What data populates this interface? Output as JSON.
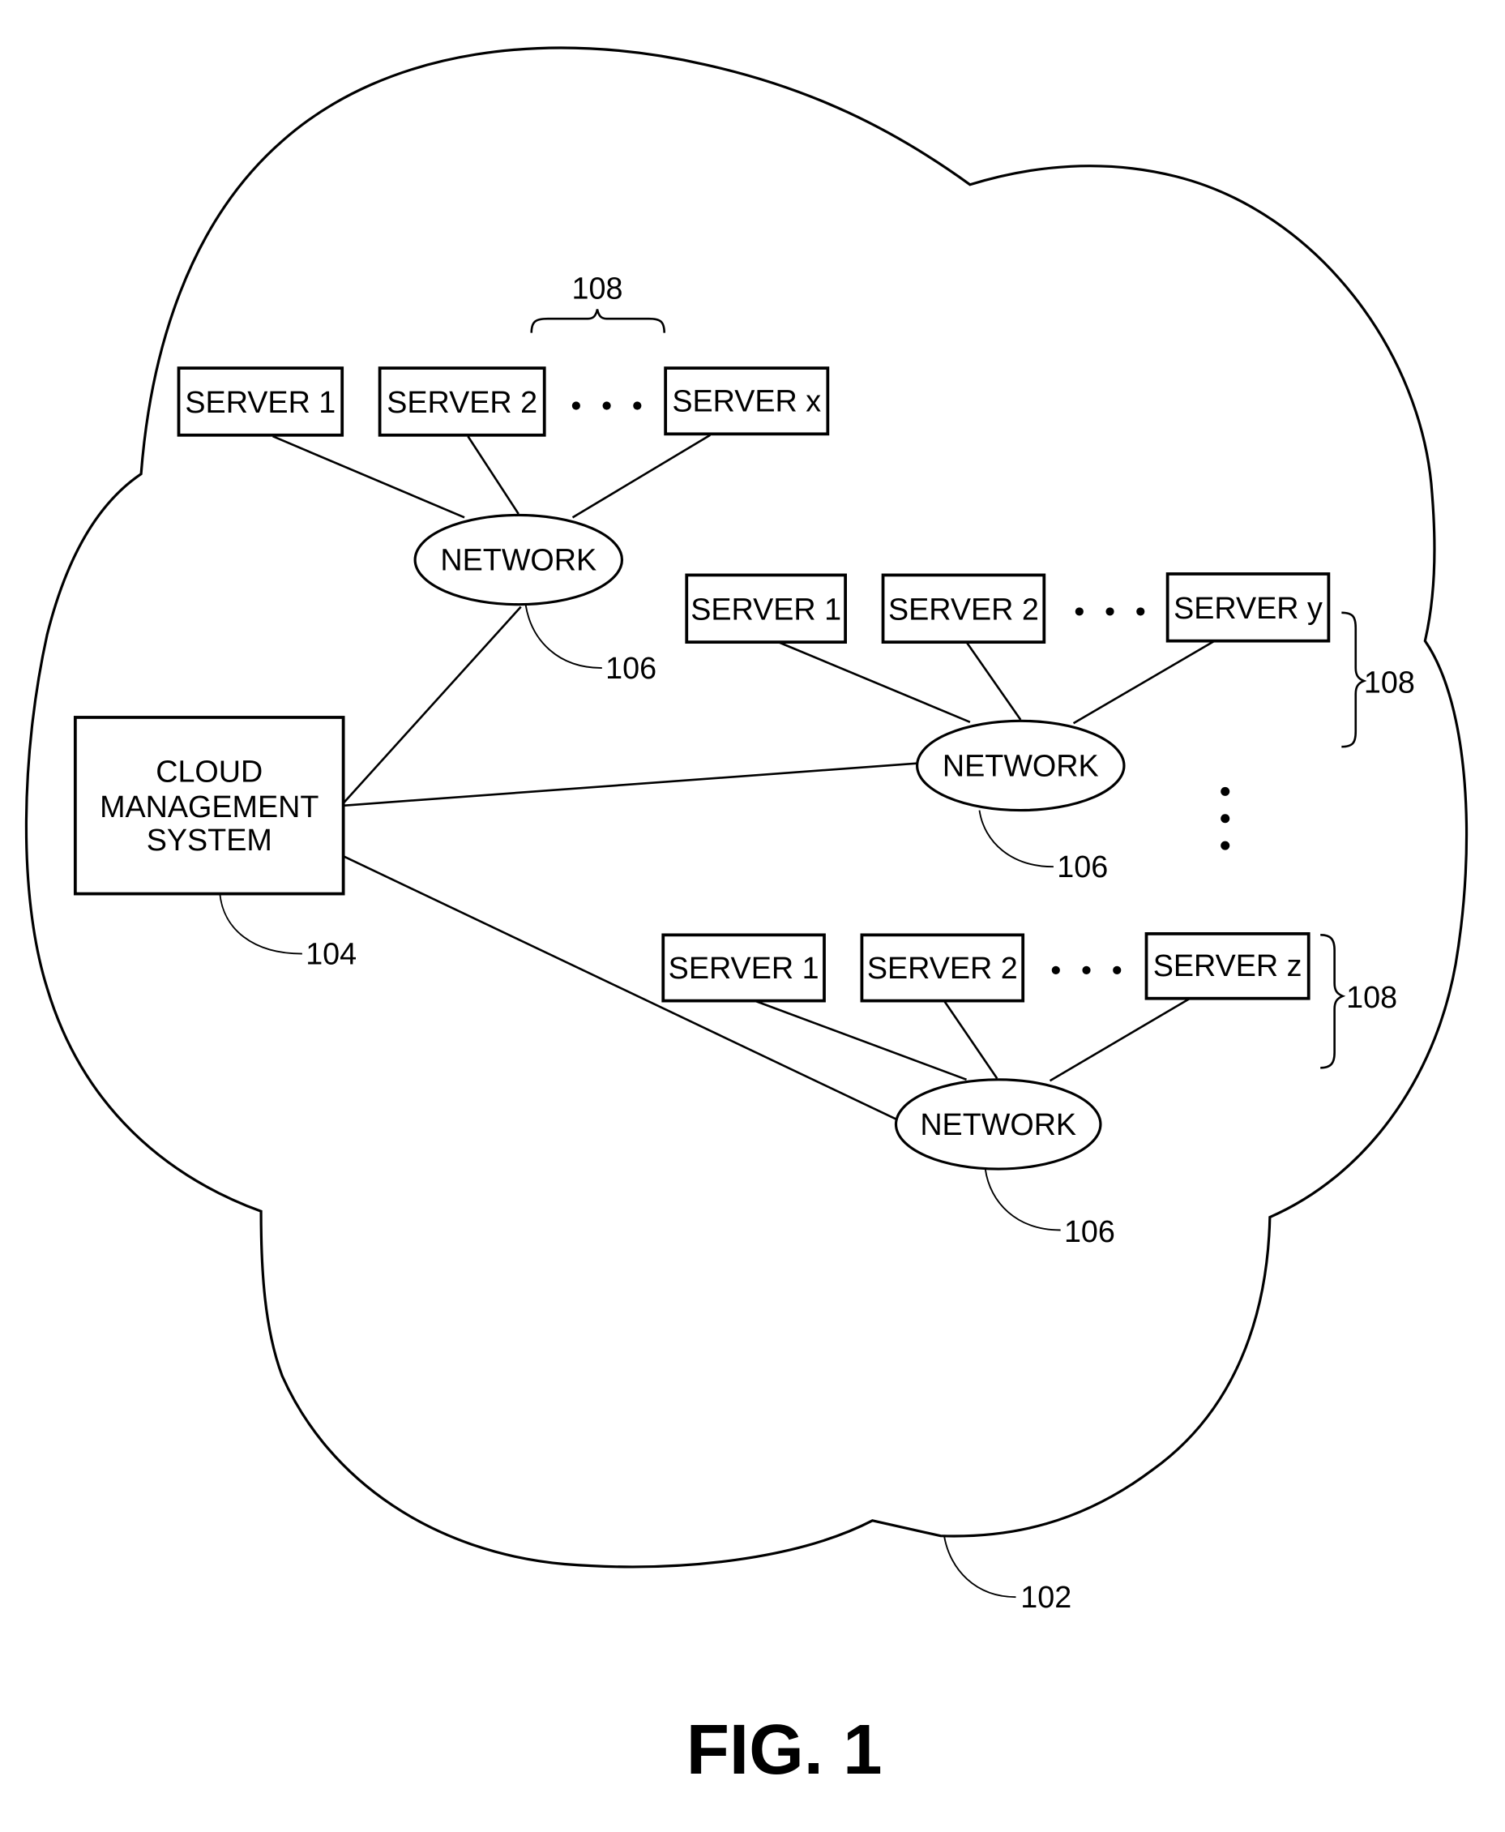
{
  "figure": {
    "caption": "FIG. 1",
    "cloud": {
      "ref": "102"
    },
    "cloud_management_system": {
      "lines": [
        "CLOUD",
        "MANAGEMENT",
        "SYSTEM"
      ],
      "ref": "104"
    },
    "network_label": "NETWORK",
    "groups": [
      {
        "network_ref": "106",
        "servers_ref": "108",
        "servers": [
          "SERVER 1",
          "SERVER 2",
          "SERVER x"
        ],
        "ellipsis": "• • •"
      },
      {
        "network_ref": "106",
        "servers_ref": "108",
        "servers": [
          "SERVER 1",
          "SERVER 2",
          "SERVER y"
        ],
        "ellipsis": "• • •"
      },
      {
        "network_ref": "106",
        "servers_ref": "108",
        "servers": [
          "SERVER 1",
          "SERVER 2",
          "SERVER z"
        ],
        "ellipsis": "• • •"
      }
    ],
    "more_groups_indicator": "vertical-ellipsis"
  }
}
